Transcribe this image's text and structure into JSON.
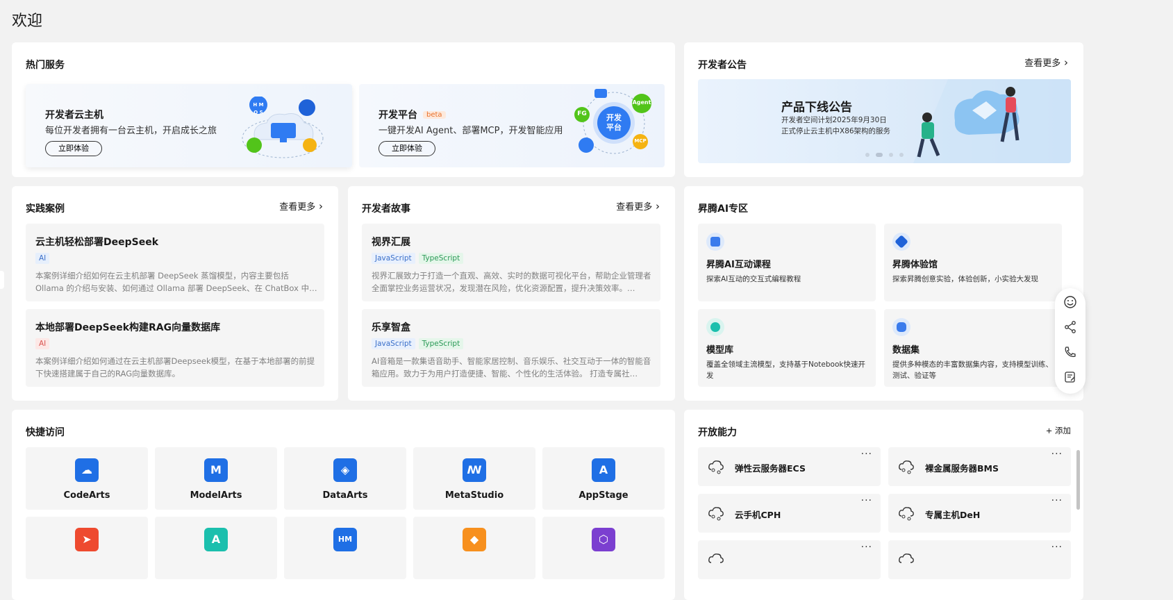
{
  "page": {
    "title": "欢迎"
  },
  "hot_services": {
    "title": "热门服务",
    "cards": [
      {
        "title": "开发者云主机",
        "desc": "每位开发者拥有一台云主机，开启成长之旅",
        "button": "立即体验"
      },
      {
        "title": "开发平台",
        "badge": "beta",
        "desc": "一键开发AI Agent、部署MCP，开发智能应用",
        "button": "立即体验",
        "bubbles": [
          "开发\n平台",
          "FG",
          "Agent",
          "MCP"
        ]
      }
    ],
    "hm_icon_text": "H M\nO S"
  },
  "announcements": {
    "title": "开发者公告",
    "more": "查看更多",
    "banner": {
      "title": "产品下线公告",
      "line1": "开发者空间计划2025年9月30日",
      "line2": "正式停止云主机中X86架构的服务"
    }
  },
  "practice": {
    "title": "实践案例",
    "more": "查看更多",
    "items": [
      {
        "title": "云主机轻松部署DeepSeek",
        "tag": "AI",
        "desc": "本案例详细介绍如何在云主机部署 DeepSeek 蒸馏模型，内容主要包括 Ollama 的介绍与安装、如何通过 Ollama 部署 DeepSeek、在 ChatBox 中…"
      },
      {
        "title": "本地部署DeepSeek构建RAG向量数据库",
        "tag": "AI",
        "desc": "本案例详细介绍如何通过在云主机部署Deepseek模型，在基于本地部署的前提下快速搭建属于自己的RAG向量数据库。"
      }
    ]
  },
  "stories": {
    "title": "开发者故事",
    "more": "查看更多",
    "items": [
      {
        "title": "视界汇展",
        "tags": [
          "JavaScript",
          "TypeScript"
        ],
        "desc": "视界汇展致力于打造一个直观、高效、实时的数据可视化平台，帮助企业管理者全面掌控业务运营状况，发现潜在风险，优化资源配置，提升决策效率。…"
      },
      {
        "title": "乐享智盒",
        "tags": [
          "JavaScript",
          "TypeScript"
        ],
        "desc": "AI音箱是一款集语音助手、智能家居控制、音乐娱乐、社交互动于一体的智能音箱应用。致力于为用户打造便捷、智能、个性化的生活体验。 打造专属社…"
      }
    ]
  },
  "ascend": {
    "title": "昇腾AI专区",
    "items": [
      {
        "title": "昇腾AI互动课程",
        "desc": "探索AI互动的交互式编程教程"
      },
      {
        "title": "昇腾体验馆",
        "desc": "探索昇腾创意实验，体验创新，小实验大发现"
      },
      {
        "title": "模型库",
        "desc": "覆盖全领域主流模型，支持基于Notebook快速开发"
      },
      {
        "title": "数据集",
        "desc": "提供多种模态的丰富数据集内容，支持模型训练、测试、验证等"
      }
    ]
  },
  "quick_access": {
    "title": "快捷访问",
    "items": [
      {
        "label": "CodeArts",
        "color": "#1f6fe5",
        "glyph": "☁"
      },
      {
        "label": "ModelArts",
        "color": "#1f6fe5",
        "glyph": "M"
      },
      {
        "label": "DataArts",
        "color": "#1f6fe5",
        "glyph": "◈"
      },
      {
        "label": "MetaStudio",
        "color": "#1f6fe5",
        "glyph": "ꟿ"
      },
      {
        "label": "AppStage",
        "color": "#1f6fe5",
        "glyph": "A"
      }
    ],
    "row2_colors": [
      "#ee4a2f",
      "#1bbfad",
      "#1f6fe5",
      "#f7901e",
      "#7b3fd0"
    ],
    "row2_glyphs": [
      "➤",
      "A",
      "HM",
      "◆",
      "⬡"
    ]
  },
  "capabilities": {
    "title": "开放能力",
    "add": "+ 添加",
    "items": [
      {
        "label": "弹性云服务器ECS"
      },
      {
        "label": "裸金属服务器BMS"
      },
      {
        "label": "云手机CPH"
      },
      {
        "label": "专属主机DeH"
      }
    ],
    "more_glyph": "···"
  },
  "colors": {
    "accent": "#1f6fe5",
    "panel_bg": "#ffffff",
    "page_bg": "#f2f2f2"
  },
  "float_icons": [
    "smile-icon",
    "share-icon",
    "phone-icon",
    "feedback-icon"
  ]
}
